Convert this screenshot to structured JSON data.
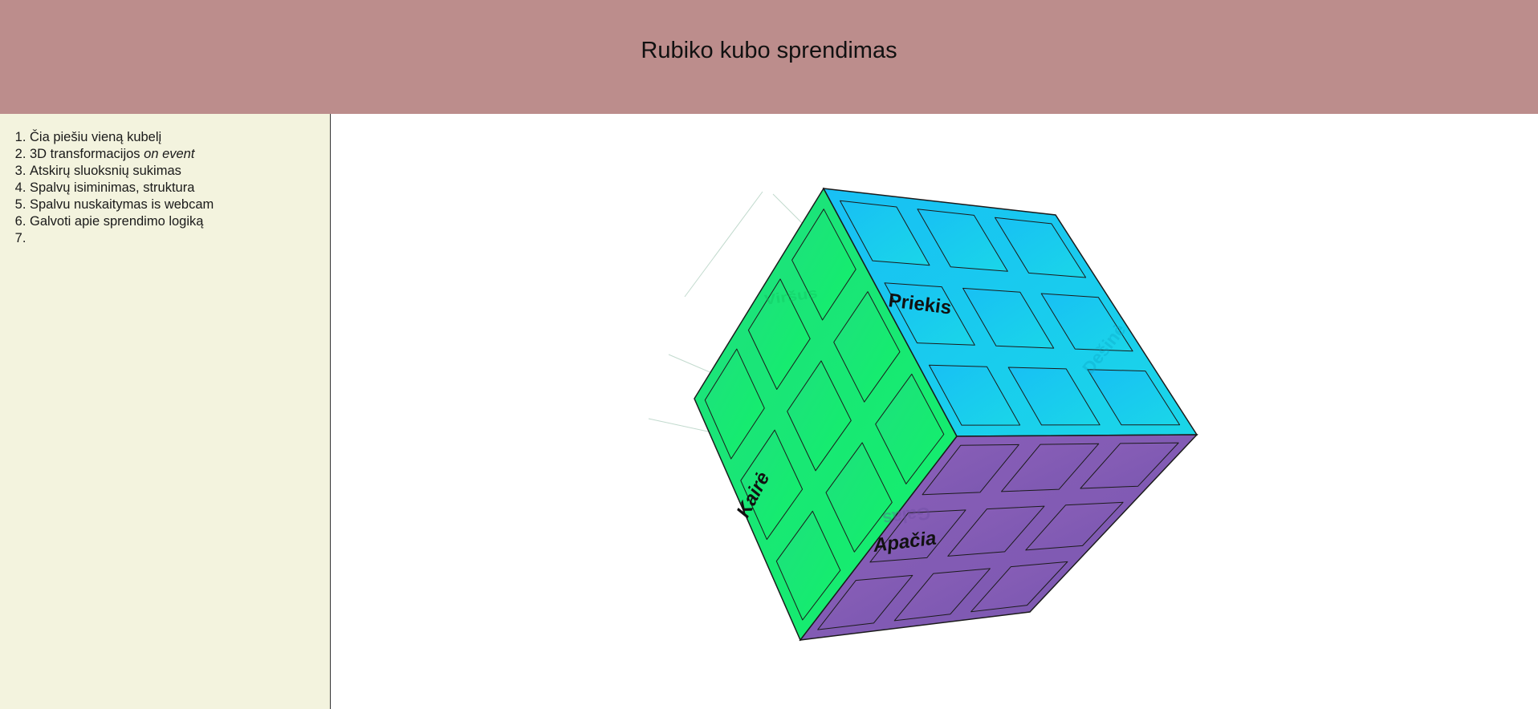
{
  "page": {
    "title": "Rubiko kubo sprendimas"
  },
  "colors": {
    "header_bg": "#bc8d8c",
    "sidebar_bg": "#f3f3de",
    "green_face": "#17e56f",
    "cyan_face": "#1ac4ec",
    "purple_face": "#7e57b4",
    "edge": "#1b1b1b"
  },
  "sidebar": {
    "items": [
      {
        "num": "1.",
        "text": "Čia piešiu vieną kubelį",
        "em": ""
      },
      {
        "num": "2.",
        "text": "3D transformacijos ",
        "em": "on event"
      },
      {
        "num": "3.",
        "text": "Atskirų sluoksnių sukimas",
        "em": ""
      },
      {
        "num": "4.",
        "text": "Spalvų isiminimas, struktura",
        "em": ""
      },
      {
        "num": "5.",
        "text": "Spalvu nuskaitymas is webcam",
        "em": ""
      },
      {
        "num": "6.",
        "text": "Galvoti apie sprendimo logiką",
        "em": ""
      },
      {
        "num": "7.",
        "text": "",
        "em": ""
      }
    ]
  },
  "cube": {
    "faces": {
      "front": "Priekis",
      "left": "Kairė",
      "bottom": "Apačia"
    },
    "ghost_labels": [
      "Viršus",
      "Dešinė",
      "Galas"
    ]
  }
}
